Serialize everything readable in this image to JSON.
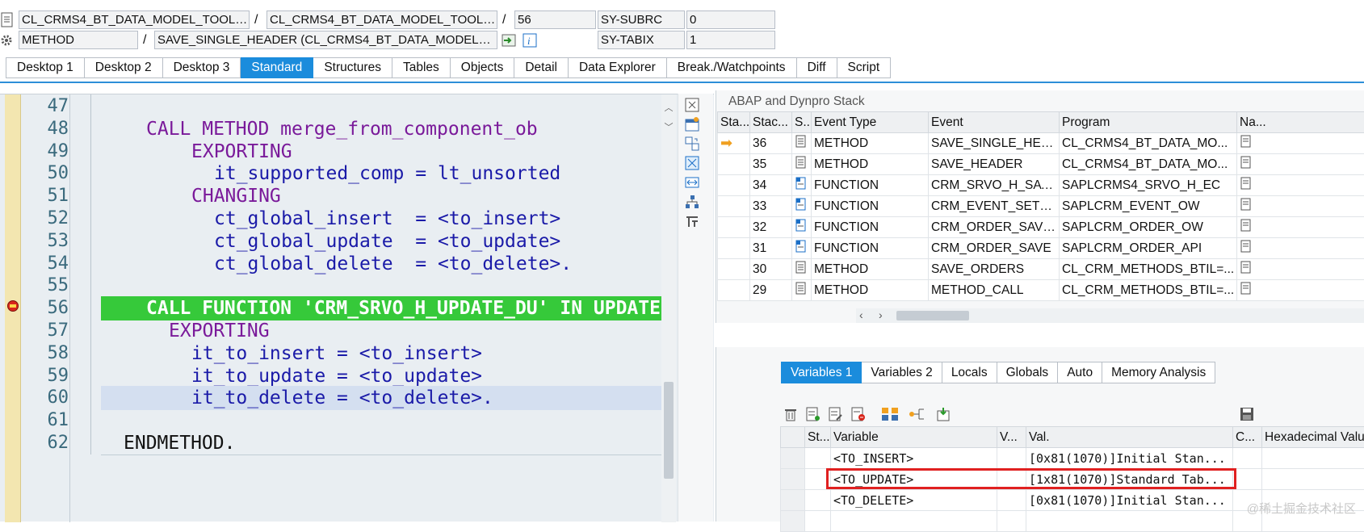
{
  "header": {
    "row1": {
      "field1": "CL_CRMS4_BT_DATA_MODEL_TOOL==...",
      "sep1": "/",
      "field2": "CL_CRMS4_BT_DATA_MODEL_TOOL==...",
      "sep2": "/",
      "line": "56",
      "sysvar": "SY-SUBRC",
      "sysval": "0"
    },
    "row2": {
      "type": "METHOD",
      "sep": "/",
      "name": "SAVE_SINGLE_HEADER (CL_CRMS4_BT_DATA_MODEL_TOO...",
      "sysvar": "SY-TABIX",
      "sysval": "1"
    }
  },
  "tabs": [
    "Desktop 1",
    "Desktop 2",
    "Desktop 3",
    "Standard",
    "Structures",
    "Tables",
    "Objects",
    "Detail",
    "Data Explorer",
    "Break./Watchpoints",
    "Diff",
    "Script"
  ],
  "active_tab": "Standard",
  "editor": {
    "lines": [
      {
        "no": "47",
        "code": ""
      },
      {
        "no": "48",
        "code": "CALL METHOD merge_from_component_ob"
      },
      {
        "no": "49",
        "code": "EXPORTING"
      },
      {
        "no": "50",
        "code": "it_supported_comp = lt_unsorted"
      },
      {
        "no": "51",
        "code": "CHANGING"
      },
      {
        "no": "52",
        "code": "ct_global_insert  = <to_insert>"
      },
      {
        "no": "53",
        "code": "ct_global_update  = <to_update>"
      },
      {
        "no": "54",
        "code": "ct_global_delete  = <to_delete>."
      },
      {
        "no": "55",
        "code": ""
      },
      {
        "no": "56",
        "code": "CALL FUNCTION 'CRM_SRVO_H_UPDATE_DU' IN UPDATE TASK"
      },
      {
        "no": "57",
        "code": "EXPORTING"
      },
      {
        "no": "58",
        "code": "it_to_insert = <to_insert>"
      },
      {
        "no": "59",
        "code": "it_to_update = <to_update>"
      },
      {
        "no": "60",
        "code": "it_to_delete = <to_delete>."
      },
      {
        "no": "61",
        "code": ""
      },
      {
        "no": "62",
        "code": "ENDMETHOD."
      }
    ]
  },
  "stack": {
    "title": "ABAP and Dynpro Stack",
    "headers": [
      "Sta...",
      "Stac...",
      "S...",
      "Event Type",
      "Event",
      "Program",
      "Na..."
    ],
    "rows": [
      {
        "level": "36",
        "type": "METHOD",
        "event": "SAVE_SINGLE_HEADER",
        "program": "CL_CRMS4_BT_DATA_MO...",
        "current": true
      },
      {
        "level": "35",
        "type": "METHOD",
        "event": "SAVE_HEADER",
        "program": "CL_CRMS4_BT_DATA_MO..."
      },
      {
        "level": "34",
        "type": "FUNCTION",
        "event": "CRM_SRVO_H_SAVE_EC",
        "program": "SAPLCRMS4_SRVO_H_EC"
      },
      {
        "level": "33",
        "type": "FUNCTION",
        "event": "CRM_EVENT_SET_EXETIM...",
        "program": "SAPLCRM_EVENT_OW"
      },
      {
        "level": "32",
        "type": "FUNCTION",
        "event": "CRM_ORDER_SAVE_OW",
        "program": "SAPLCRM_ORDER_OW"
      },
      {
        "level": "31",
        "type": "FUNCTION",
        "event": "CRM_ORDER_SAVE",
        "program": "SAPLCRM_ORDER_API"
      },
      {
        "level": "30",
        "type": "METHOD",
        "event": "SAVE_ORDERS",
        "program": "CL_CRM_METHODS_BTIL=..."
      },
      {
        "level": "29",
        "type": "METHOD",
        "event": "METHOD_CALL",
        "program": "CL_CRM_METHODS_BTIL=..."
      }
    ]
  },
  "var_tabs": [
    "Variables 1",
    "Variables 2",
    "Locals",
    "Globals",
    "Auto",
    "Memory Analysis"
  ],
  "active_var_tab": "Variables 1",
  "variables": {
    "headers": [
      "St...",
      "Variable",
      "V...",
      "Val.",
      "C...",
      "Hexadecimal Value"
    ],
    "rows": [
      {
        "name": "<TO_INSERT>",
        "value": "[0x81(1070)]Initial Stan..."
      },
      {
        "name": "<TO_UPDATE>",
        "value": "[1x81(1070)]Standard Tab...",
        "highlight": true
      },
      {
        "name": "<TO_DELETE>",
        "value": "[0x81(1070)]Initial Stan..."
      }
    ]
  },
  "watermark": "@稀土掘金技术社区",
  "colors": {
    "accent": "#1b8cdc",
    "current_line": "#36c93a",
    "highlight_box": "#e02020"
  }
}
